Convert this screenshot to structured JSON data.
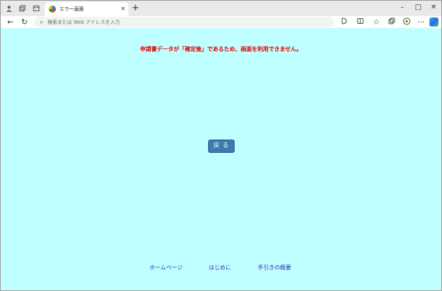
{
  "browser": {
    "tab": {
      "title": "エラー画面",
      "close": "×"
    },
    "new_tab": "+",
    "window_controls": {
      "minimize": "–",
      "maximize": "□",
      "close": "✕"
    },
    "address": {
      "placeholder": "検索または Web アドレスを入力"
    },
    "icons": {
      "profile": "profile-icon",
      "workspaces": "workspaces-icon",
      "tab_actions": "tab-actions-icon",
      "back": "back-arrow-icon",
      "refresh": "refresh-icon",
      "search": "search-icon",
      "read_aloud": "read-aloud-icon",
      "split_screen": "split-screen-icon",
      "favorites": "favorites-icon",
      "collections": "collections-icon",
      "extensions": "extensions-icon",
      "more": "more-icon",
      "copilot": "copilot-icon"
    }
  },
  "page": {
    "error_message": "申請書データが「確定後」であるため、画面を利用できません。",
    "back_button": "戻る",
    "footer_links": [
      "ホームページ",
      "はじめに",
      "手引きの概要"
    ],
    "colors": {
      "background": "#c0ffff",
      "error_text": "#e00000",
      "button": "#3d7ab0",
      "link": "#3030c0"
    }
  }
}
